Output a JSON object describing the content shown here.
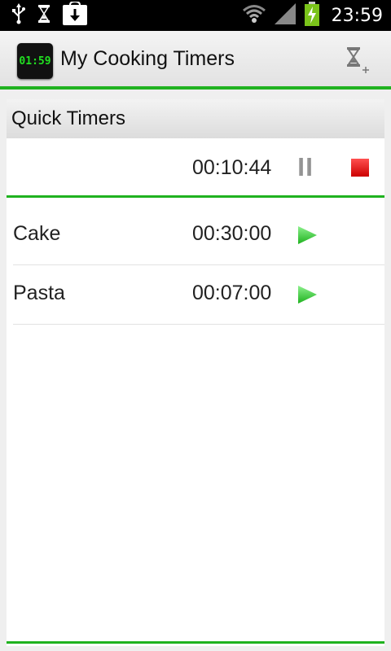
{
  "status_bar": {
    "time": "23:59",
    "icons": [
      "usb-icon",
      "hourglass-icon",
      "download-icon",
      "wifi-icon",
      "signal-icon",
      "battery-charging-icon"
    ]
  },
  "action_bar": {
    "app_icon_text": "01:59",
    "title": "My Cooking Timers",
    "add_timer_icon": "add-timer-icon"
  },
  "quick_timers": {
    "title": "Quick Timers",
    "running": {
      "time": "00:10:44",
      "pause_icon": "pause-icon",
      "stop_icon": "stop-icon"
    }
  },
  "timers": [
    {
      "name": "Cake",
      "time": "00:30:00",
      "icon": "play-icon"
    },
    {
      "name": "Pasta",
      "time": "00:07:00",
      "icon": "play-icon"
    }
  ],
  "colors": {
    "accent": "#1fb21f",
    "stop": "#e50000",
    "play": "#33cc33"
  }
}
